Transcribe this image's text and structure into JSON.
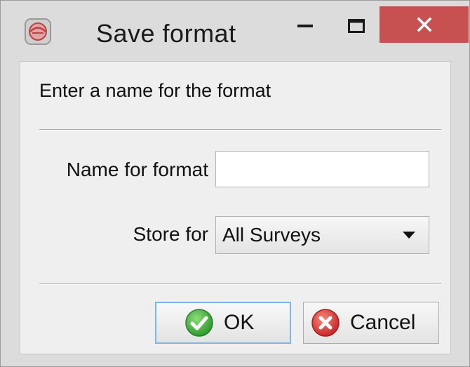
{
  "window": {
    "title": "Save format",
    "icon": "app-logo-icon",
    "controls": {
      "minimize": "minimize-icon",
      "maximize": "maximize-icon",
      "close": "close-icon"
    },
    "close_color": "#c75050"
  },
  "dialog": {
    "prompt": "Enter a name for the format",
    "name_label": "Name for format",
    "name_value": "",
    "store_label": "Store for",
    "store_selected": "All Surveys"
  },
  "buttons": {
    "ok_label": "OK",
    "ok_icon": "check-circle-icon",
    "cancel_label": "Cancel",
    "cancel_icon": "x-circle-icon"
  }
}
